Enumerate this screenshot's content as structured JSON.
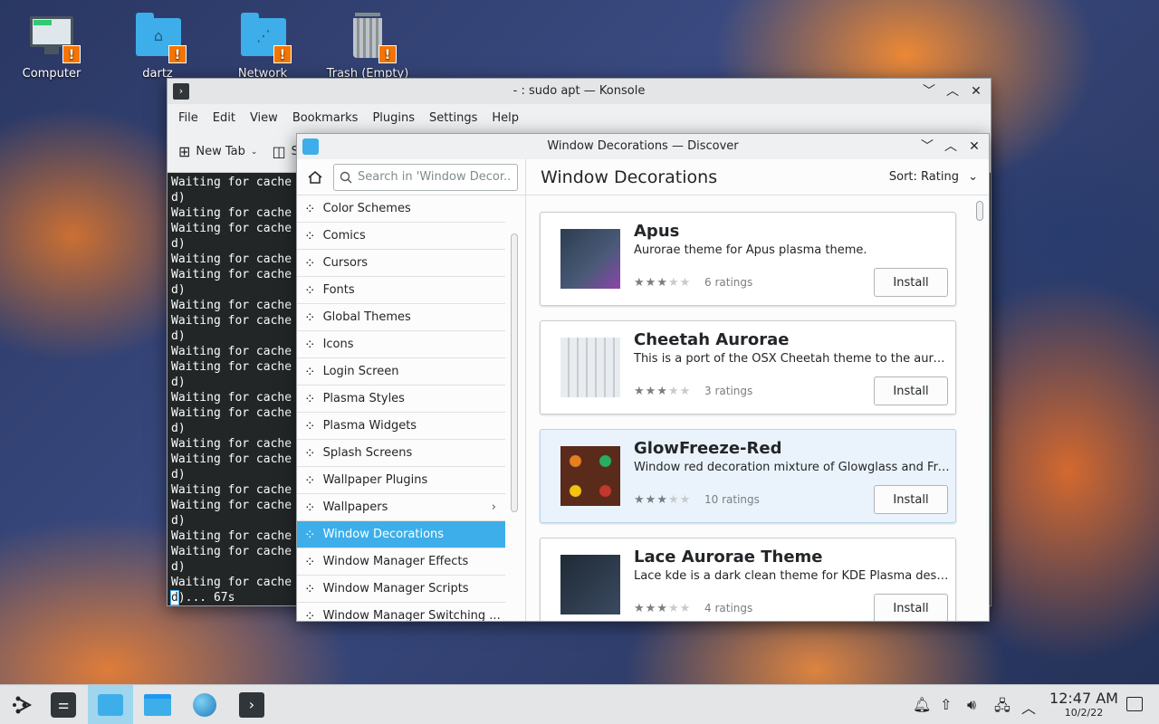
{
  "desktop": {
    "icons": [
      {
        "label": "Computer",
        "icon": "computer-icon"
      },
      {
        "label": "dartz",
        "icon": "home-folder-icon"
      },
      {
        "label": "Network",
        "icon": "network-folder-icon"
      },
      {
        "label": "Trash (Empty)",
        "icon": "trash-icon"
      }
    ]
  },
  "konsole": {
    "title": "- : sudo apt — Konsole",
    "menu": [
      "File",
      "Edit",
      "View",
      "Bookmarks",
      "Plugins",
      "Settings",
      "Help"
    ],
    "toolbar": {
      "new_tab": "New Tab",
      "split": "S"
    },
    "line_a": "Waiting for cache",
    "line_b": "d)",
    "last_suffix": ")... 67s",
    "cursor_char": "d"
  },
  "discover": {
    "title": "Window Decorations — Discover",
    "search_placeholder": "Search in 'Window Decor...",
    "heading": "Window Decorations",
    "sort": "Sort: Rating",
    "categories": [
      "Color Schemes",
      "Comics",
      "Cursors",
      "Fonts",
      "Global Themes",
      "Icons",
      "Login Screen",
      "Plasma Styles",
      "Plasma Widgets",
      "Splash Screens",
      "Wallpaper Plugins",
      "Wallpapers",
      "Window Decorations",
      "Window Manager Effects",
      "Window Manager Scripts",
      "Window Manager Switching ..."
    ],
    "selected_category": "Window Decorations",
    "apps": [
      {
        "name": "Apus",
        "desc": "Aurorae theme for Apus plasma theme.",
        "rating": 3,
        "ratings": "6 ratings",
        "button": "Install"
      },
      {
        "name": "Cheetah Aurorae",
        "desc": "This is a port of the OSX Cheetah theme to the aurorae ...",
        "rating": 3,
        "ratings": "3 ratings",
        "button": "Install"
      },
      {
        "name": "GlowFreeze-Red",
        "desc": "Window red decoration mixture of Glowglass and Freeze",
        "rating": 3,
        "ratings": "10 ratings",
        "button": "Install"
      },
      {
        "name": "Lace Aurorae Theme",
        "desc": "Lace kde is a dark clean theme for KDE Plasma desktop.",
        "rating": 3,
        "ratings": "4 ratings",
        "button": "Install"
      }
    ]
  },
  "taskbar": {
    "time": "12:47 AM",
    "date": "10/2/22"
  }
}
